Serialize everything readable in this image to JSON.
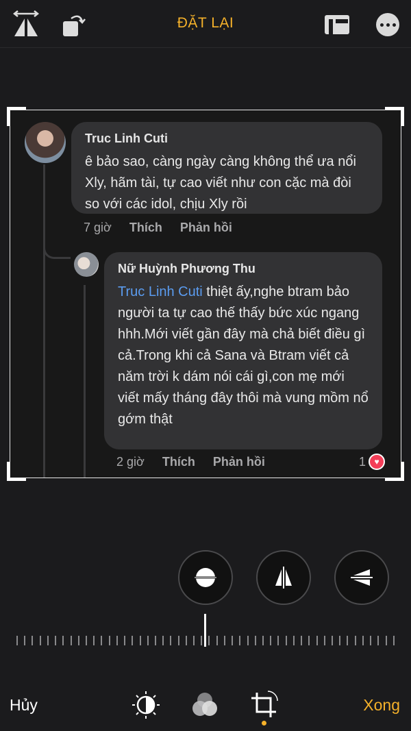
{
  "toolbar": {
    "reset_label": "ĐẶT LẠI",
    "icons": [
      "flip-icon",
      "rotate-icon",
      "aspect-ratio-icon",
      "more-icon"
    ]
  },
  "comments": [
    {
      "author": "Truc Linh Cuti",
      "text": "ê bảo sao, càng ngày càng không thể ưa nổi Xly, hãm tài, tự cao viết như con cặc mà đòi so với các idol, chịu Xly rồi",
      "time": "7 giờ",
      "like_label": "Thích",
      "reply_label": "Phản hồi"
    },
    {
      "author": "Nữ Huỳnh Phương Thu",
      "mention": "Truc Linh Cuti",
      "text": " thiệt ấy,nghe btram bảo người ta tự cao thế thấy bức xúc ngang hhh.Mới viết gần đây mà chả biết điều gì cả.Trong khi cả Sana và Btram viết cả năm trời k dám nói cái gì,con mẹ mới viết mấy tháng đây thôi mà vung mồm nổ gớm thật",
      "time": "2 giờ",
      "like_label": "Thích",
      "reply_label": "Phản hồi",
      "reaction_count": "1"
    }
  ],
  "adjust_buttons": [
    "straighten-icon",
    "vertical-perspective-icon",
    "horizontal-perspective-icon"
  ],
  "bottom_bar": {
    "cancel_label": "Hủy",
    "done_label": "Xong",
    "tools": [
      "adjust-icon",
      "filters-icon",
      "crop-icon"
    ],
    "accent": "#f5b12a"
  }
}
